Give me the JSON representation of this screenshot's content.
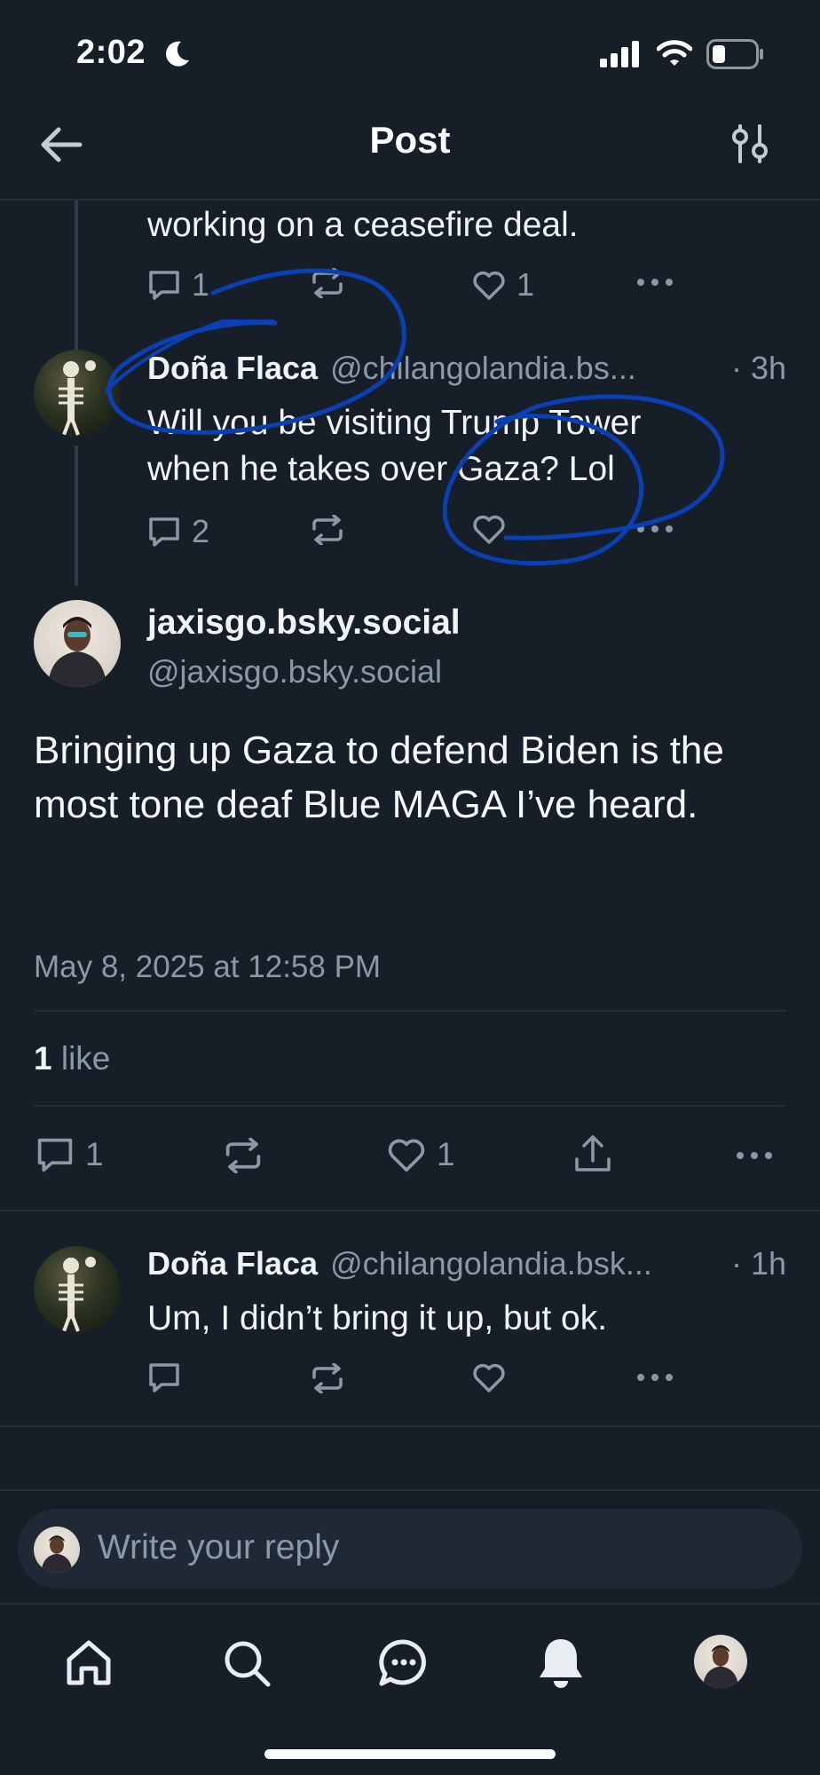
{
  "status_bar": {
    "time": "2:02"
  },
  "header": {
    "title": "Post"
  },
  "parent_post": {
    "text_tail": "working on a ceasefire deal.",
    "reply_count": "1",
    "like_count": "1"
  },
  "reply_1": {
    "author": "Doña Flaca",
    "handle": "@chilangolandia.bs...",
    "time": "· 3h",
    "text": "Will you be visiting Trump Tower when he takes over Gaza? Lol",
    "reply_count": "2"
  },
  "main_post": {
    "author": "jaxisgo.bsky.social",
    "handle": "@jaxisgo.bsky.social",
    "text": "Bringing up Gaza to defend Biden is the most tone deaf Blue MAGA I’ve heard.",
    "date": "May 8, 2025 at 12:58 PM",
    "likes_number": "1",
    "likes_label": " like",
    "reply_count": "1",
    "like_count": "1"
  },
  "reply_2": {
    "author": "Doña Flaca",
    "handle": "@chilangolandia.bsk...",
    "time": "· 1h",
    "text": "Um, I didn’t bring it up, but ok."
  },
  "composer": {
    "placeholder": "Write your reply"
  },
  "annotation_color": "#0a3fb5",
  "icons": [
    "back-arrow-icon",
    "thread-settings-icon",
    "reply-icon",
    "repost-icon",
    "like-icon",
    "more-icon",
    "share-icon",
    "home-icon",
    "search-icon",
    "chat-icon",
    "notifications-icon"
  ]
}
